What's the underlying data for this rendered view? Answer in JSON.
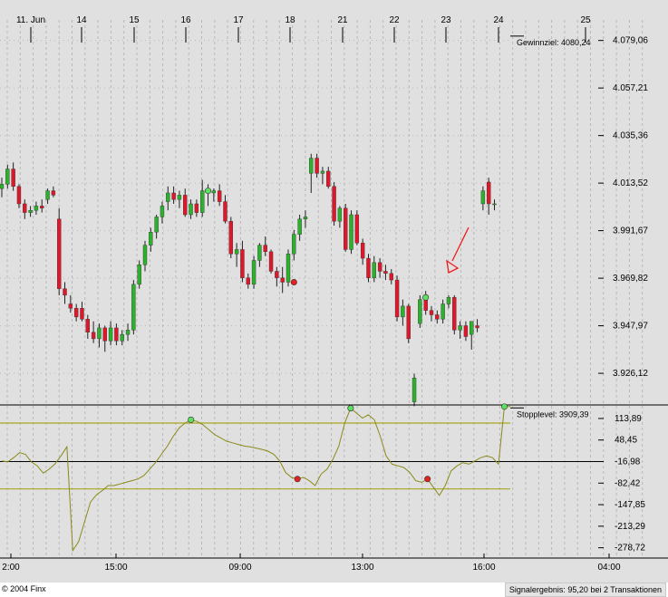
{
  "footer": {
    "copyright": "© 2004 Finx",
    "signal_result": "Signalergebnis: 95,20 bei 2 Transaktionen"
  },
  "colors": {
    "background": "#e0e0e0",
    "grid": "#b8b8b8",
    "up_candle": "#2bb12b",
    "down_candle": "#e0162a",
    "oscillator": "#8a8a1a",
    "band": "#a8a820",
    "buy_marker": "#5de05d",
    "sell_marker": "#e62020",
    "arrow": "#ee1c1c"
  },
  "chart_data": [
    {
      "type": "candlestick",
      "date_labels": [
        "11. Jun",
        "14",
        "15",
        "16",
        "17",
        "18",
        "21",
        "22",
        "23",
        "24",
        "25"
      ],
      "y_ticks": [
        "4.079,06",
        "4.057,21",
        "4.035,36",
        "4.013,52",
        "3.991,67",
        "3.969,82",
        "3.947,97",
        "3.926,12"
      ],
      "ylim": [
        3912,
        4086
      ],
      "annotations": [
        {
          "label": "Gewinnziel: 4080,24",
          "value": 4080.24
        },
        {
          "label": "Stopplevel: 3909,39",
          "value": 3909.39
        }
      ],
      "candles": [
        [
          4011,
          4016,
          4007,
          4013
        ],
        [
          4013,
          4022,
          4011,
          4020
        ],
        [
          4020,
          4023,
          4010,
          4012
        ],
        [
          4012,
          4013,
          4002,
          4004
        ],
        [
          4004,
          4006,
          3997,
          4000
        ],
        [
          4000,
          4003,
          3998,
          4001
        ],
        [
          4001,
          4005,
          3999,
          4003
        ],
        [
          4003,
          4006,
          4000,
          4002
        ],
        [
          4006,
          4011,
          4004,
          4010
        ],
        [
          4010,
          4012,
          4007,
          4008
        ],
        [
          3997,
          4002,
          3962,
          3965
        ],
        [
          3965,
          3968,
          3958,
          3962
        ],
        [
          3958,
          3962,
          3954,
          3956
        ],
        [
          3956,
          3958,
          3950,
          3952
        ],
        [
          3956,
          3959,
          3950,
          3951
        ],
        [
          3951,
          3953,
          3942,
          3945
        ],
        [
          3945,
          3950,
          3940,
          3942
        ],
        [
          3942,
          3949,
          3938,
          3947
        ],
        [
          3947,
          3948,
          3936,
          3941
        ],
        [
          3941,
          3950,
          3939,
          3947
        ],
        [
          3947,
          3949,
          3939,
          3941
        ],
        [
          3941,
          3946,
          3939,
          3944
        ],
        [
          3944,
          3949,
          3941,
          3946
        ],
        [
          3946,
          3969,
          3944,
          3967
        ],
        [
          3967,
          3978,
          3965,
          3976
        ],
        [
          3976,
          3987,
          3973,
          3985
        ],
        [
          3985,
          3993,
          3982,
          3991
        ],
        [
          3991,
          3999,
          3988,
          3998
        ],
        [
          3998,
          4005,
          3995,
          4003
        ],
        [
          4005,
          4012,
          4001,
          4009
        ],
        [
          4009,
          4012,
          4004,
          4006
        ],
        [
          4006,
          4010,
          4002,
          4008
        ],
        [
          4008,
          4011,
          3998,
          3999
        ],
        [
          3999,
          4006,
          3997,
          4004
        ],
        [
          4004,
          4006,
          3998,
          4000
        ],
        [
          4000,
          4015,
          3998,
          4010
        ],
        [
          4010,
          4013,
          4003,
          4009
        ],
        [
          4009,
          4011,
          4005,
          4010
        ],
        [
          4010,
          4013,
          4003,
          4005
        ],
        [
          4005,
          4008,
          3995,
          3996
        ],
        [
          3996,
          3998,
          3979,
          3981
        ],
        [
          3981,
          3986,
          3975,
          3983
        ],
        [
          3983,
          3987,
          3968,
          3970
        ],
        [
          3970,
          3972,
          3965,
          3967
        ],
        [
          3967,
          3980,
          3965,
          3978
        ],
        [
          3978,
          3986,
          3975,
          3985
        ],
        [
          3985,
          3989,
          3980,
          3982
        ],
        [
          3982,
          3983,
          3972,
          3973
        ],
        [
          3973,
          3975,
          3966,
          3970
        ],
        [
          3970,
          3975,
          3963,
          3968
        ],
        [
          3968,
          3983,
          3966,
          3981
        ],
        [
          3981,
          3992,
          3978,
          3990
        ],
        [
          3990,
          3999,
          3987,
          3997
        ],
        [
          3997,
          4001,
          3993,
          3998
        ],
        [
          4018,
          4027,
          4009,
          4025
        ],
        [
          4025,
          4027,
          4016,
          4018
        ],
        [
          4018,
          4021,
          4013,
          4019
        ],
        [
          4019,
          4021,
          4011,
          4012
        ],
        [
          4012,
          4014,
          3994,
          3996
        ],
        [
          3996,
          4003,
          3993,
          4002
        ],
        [
          4002,
          4004,
          3982,
          3983
        ],
        [
          3983,
          4001,
          3981,
          3999
        ],
        [
          3999,
          4001,
          3985,
          3986
        ],
        [
          3986,
          3988,
          3976,
          3979
        ],
        [
          3979,
          3981,
          3968,
          3970
        ],
        [
          3970,
          3980,
          3968,
          3977
        ],
        [
          3977,
          3979,
          3970,
          3973
        ],
        [
          3973,
          3976,
          3969,
          3972
        ],
        [
          3972,
          3974,
          3967,
          3969
        ],
        [
          3969,
          3971,
          3950,
          3952
        ],
        [
          3952,
          3960,
          3948,
          3957
        ],
        [
          3957,
          3958,
          3940,
          3942
        ],
        [
          3913,
          3926,
          3911,
          3924
        ],
        [
          3949,
          3962,
          3947,
          3960
        ],
        [
          3960,
          3964,
          3953,
          3955
        ],
        [
          3955,
          3957,
          3950,
          3953
        ],
        [
          3953,
          3955,
          3949,
          3951
        ],
        [
          3951,
          3960,
          3949,
          3958
        ],
        [
          3958,
          3962,
          3956,
          3961
        ],
        [
          3961,
          3962,
          3944,
          3946
        ],
        [
          3946,
          3950,
          3942,
          3948
        ],
        [
          3948,
          3950,
          3941,
          3943
        ],
        [
          3944,
          3950,
          3937,
          3950
        ],
        [
          3948,
          3951,
          3945,
          3947
        ],
        [
          4004,
          4012,
          4001,
          4010
        ],
        [
          4014,
          4016,
          3999,
          4004
        ],
        [
          4004,
          4006,
          4001,
          4004
        ]
      ],
      "signals": [
        {
          "candle": 36,
          "kind": "buy",
          "price": 4010
        },
        {
          "candle": 51,
          "kind": "sell",
          "price": 3968
        },
        {
          "candle": 74,
          "kind": "buy",
          "price": 3961
        }
      ]
    },
    {
      "type": "line",
      "x_labels": [
        "2:00",
        "15:00",
        "09:00",
        "13:00",
        "16:00",
        "04:00"
      ],
      "y_ticks": [
        "113,89",
        "48,45",
        "-16,98",
        "-82,42",
        "-147,85",
        "-213,29",
        "-278,72"
      ],
      "ylim": [
        -310,
        155
      ],
      "bands": [
        100,
        -100
      ],
      "zero_line": -16.98,
      "values": [
        -15,
        -18,
        -5,
        10,
        5,
        -18,
        -30,
        -52,
        -40,
        -24,
        0,
        28,
        -287,
        -260,
        -200,
        -140,
        -118,
        -105,
        -90,
        -90,
        -85,
        -80,
        -75,
        -70,
        -60,
        -40,
        -20,
        5,
        30,
        60,
        85,
        100,
        110,
        105,
        95,
        80,
        65,
        55,
        45,
        40,
        35,
        30,
        28,
        24,
        20,
        15,
        5,
        -15,
        -50,
        -65,
        -70,
        -65,
        -75,
        -90,
        -55,
        -40,
        -10,
        30,
        100,
        145,
        130,
        115,
        125,
        110,
        60,
        0,
        -25,
        -30,
        -35,
        -50,
        -75,
        -80,
        -70,
        -95,
        -120,
        -90,
        -45,
        -30,
        -20,
        -25,
        -15,
        -5,
        0,
        -5,
        -25,
        150,
        150
      ],
      "signals": [
        {
          "index": 32,
          "kind": "buy"
        },
        {
          "index": 50,
          "kind": "sell"
        },
        {
          "index": 59,
          "kind": "buy"
        },
        {
          "index": 72,
          "kind": "sell"
        },
        {
          "index": 85,
          "kind": "buy"
        }
      ]
    }
  ]
}
